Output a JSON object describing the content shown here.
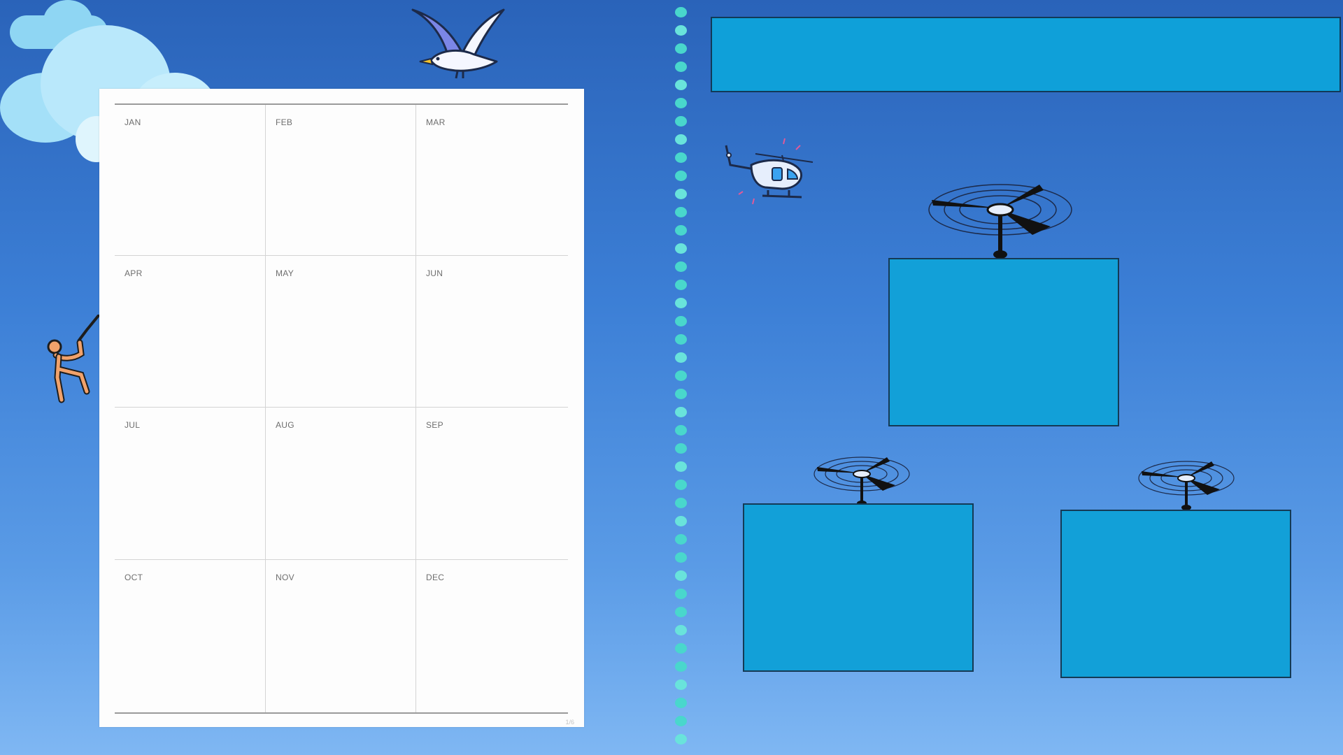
{
  "calendar": {
    "months": [
      "JAN",
      "FEB",
      "MAR",
      "APR",
      "MAY",
      "JUN",
      "JUL",
      "AUG",
      "SEP",
      "OCT",
      "NOV",
      "DEC"
    ],
    "page_indicator": "1/6"
  },
  "colors": {
    "background_top": "#2a63b9",
    "background_bottom": "#7fb7f3",
    "box_fill": "#12a0d8",
    "box_border": "#143a55",
    "divider_dots": "#49d7cc"
  },
  "decorations": [
    "cloud-icon",
    "seagull-icon",
    "climber-icon",
    "helicopter-icon",
    "rotor-icon"
  ]
}
